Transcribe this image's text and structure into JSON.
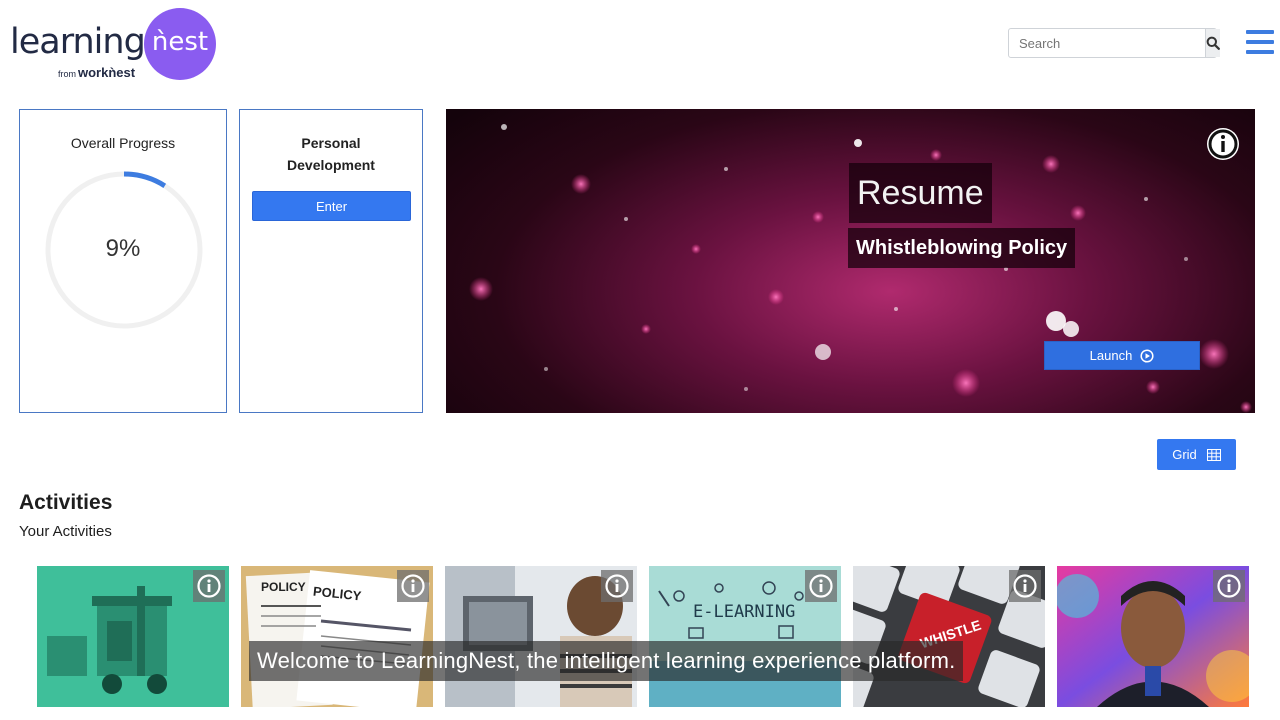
{
  "header": {
    "logo_word": "learning",
    "logo_nest": "ǹest",
    "logo_from": "from",
    "logo_brand": "workǹest",
    "search_placeholder": "Search"
  },
  "progress_card": {
    "title": "Overall Progress",
    "percent_label": "9%",
    "percent_value": 9
  },
  "dev_card": {
    "title": "Personal Development",
    "enter_label": "Enter"
  },
  "hero": {
    "resume_label": "Resume",
    "course_title": "Whistleblowing Policy",
    "launch_label": "Launch"
  },
  "view_toggle": {
    "grid_label": "Grid"
  },
  "activities": {
    "title": "Activities",
    "subtitle": "Your Activities",
    "tiles": [
      {
        "name": "tile-cleaning-cart",
        "bg": "#3fbf9a",
        "text": ""
      },
      {
        "name": "tile-policy-documents",
        "bg": "#e9e4da",
        "text": "POLICY"
      },
      {
        "name": "tile-person-computer",
        "bg": "#c9d2dc",
        "text": ""
      },
      {
        "name": "tile-e-learning",
        "bg": "#9fd3cf",
        "text": "E-LEARNING"
      },
      {
        "name": "tile-whistle-blower-key",
        "bg": "#cfd2d6",
        "text": "WHISTLE"
      },
      {
        "name": "tile-portrait-colorful",
        "bg": "#d04aa8",
        "text": ""
      }
    ]
  },
  "caption": "Welcome to LearningNest, the intelligent learning experience platform.",
  "colors": {
    "brand_purple": "#8a5cf0",
    "primary_blue": "#3478f0",
    "progress_blue": "#3d7ce0"
  }
}
